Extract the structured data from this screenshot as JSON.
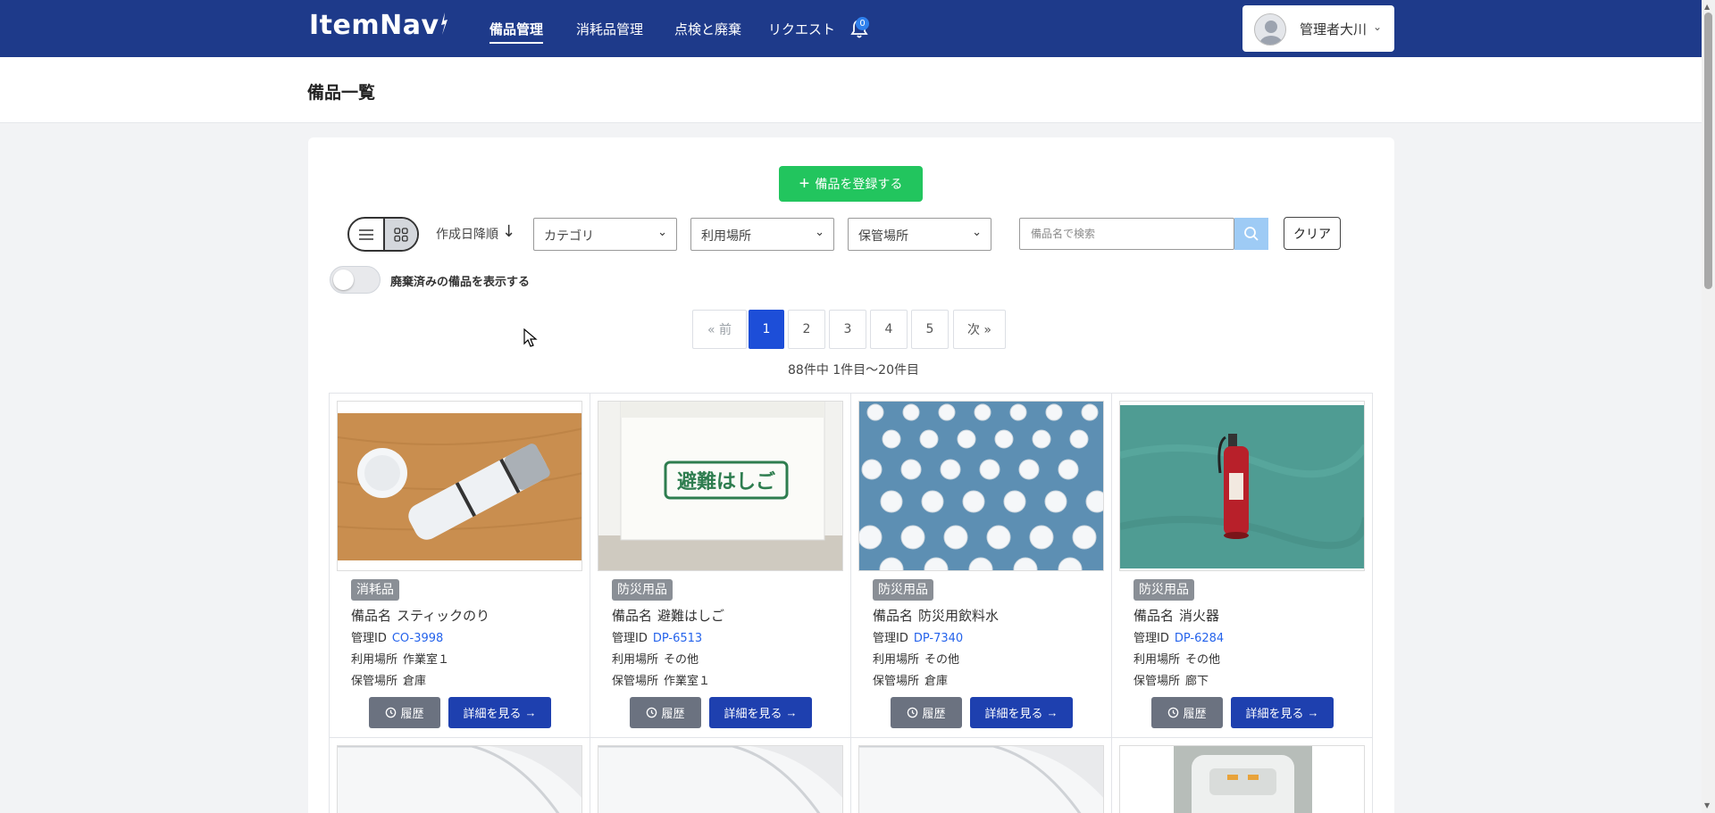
{
  "header": {
    "logo": "ItemNav",
    "nav": [
      "備品管理",
      "消耗品管理",
      "点検と廃棄",
      "リクエスト"
    ],
    "notification_count": "0",
    "user_name": "管理者大川"
  },
  "page": {
    "title": "備品一覧"
  },
  "toolbar": {
    "add_button": "備品を登録する",
    "sort_label": "作成日降順",
    "filters": [
      "カテゴリ",
      "利用場所",
      "保管場所"
    ],
    "search_placeholder": "備品名で検索",
    "clear_button": "クリア",
    "show_disposed_label": "廃棄済みの備品を表示する"
  },
  "pagination": {
    "prev": "« 前",
    "pages": [
      "1",
      "2",
      "3",
      "4",
      "5"
    ],
    "next": "次 »",
    "current": "1",
    "summary": "88件中 1件目～20件目"
  },
  "labels": {
    "name": "備品名",
    "id": "管理ID",
    "use_location": "利用場所",
    "storage_location": "保管場所",
    "history_button": "履歴",
    "detail_button": "詳細を見る"
  },
  "items": [
    {
      "category": "消耗品",
      "name": "スティックのり",
      "id": "CO-3998",
      "use_location": "作業室１",
      "storage_location": "倉庫"
    },
    {
      "category": "防災用品",
      "name": "避難はしご",
      "id": "DP-6513",
      "use_location": "その他",
      "storage_location": "作業室１"
    },
    {
      "category": "防災用品",
      "name": "防災用飲料水",
      "id": "DP-7340",
      "use_location": "その他",
      "storage_location": "倉庫"
    },
    {
      "category": "防災用品",
      "name": "消火器",
      "id": "DP-6284",
      "use_location": "その他",
      "storage_location": "廊下"
    }
  ],
  "image_text": {
    "ladder_box": "避難はしご"
  }
}
